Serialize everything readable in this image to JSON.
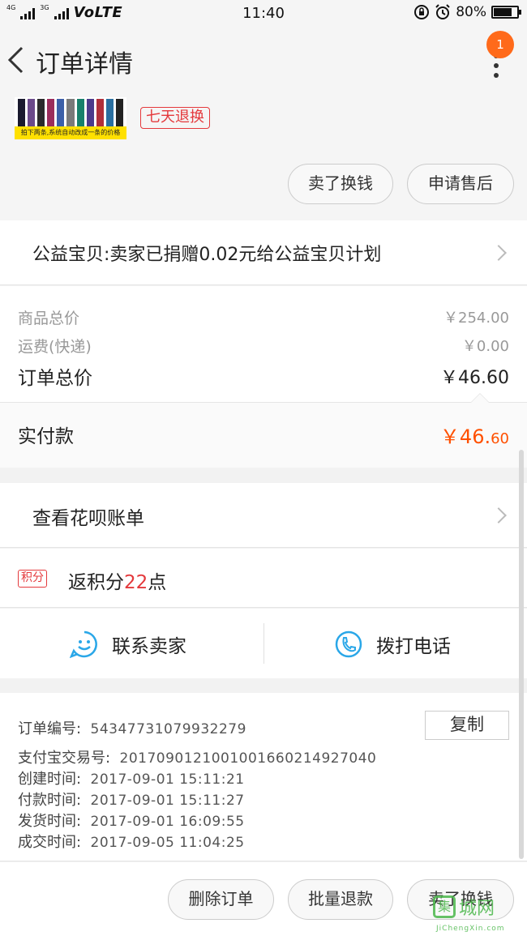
{
  "status_bar": {
    "net_left_small": "4G",
    "net_right_small": "3G",
    "volte": "VoLTE",
    "time": "11:40",
    "battery_percent_label": "80%",
    "battery_level": 0.8
  },
  "nav": {
    "title": "订单详情",
    "badge_count": "1"
  },
  "product": {
    "thumb_caption": "拍下两条,系统自动改成一条的价格",
    "tag": "七天退换",
    "stripe_colors": [
      "#1a1a2e",
      "#6b4a8a",
      "#2b2b2b",
      "#9b2d5b",
      "#3c5fa8",
      "#7a7a7a",
      "#18806b",
      "#4b3b8b",
      "#b0303a",
      "#2a6fa0",
      "#222222"
    ],
    "buttons": {
      "sell": "卖了换钱",
      "after_sale": "申请售后"
    }
  },
  "charity": {
    "text": "公益宝贝:卖家已捐赠0.02元给公益宝贝计划"
  },
  "prices": {
    "goods_total_label": "商品总价",
    "goods_total_value": "￥254.00",
    "shipping_label": "运费(快递)",
    "shipping_value": "￥0.00",
    "order_total_label": "订单总价",
    "order_total_value": "￥46.60"
  },
  "paid": {
    "label": "实付款",
    "value_main": "￥46.",
    "value_dec": "60"
  },
  "huabei": {
    "text": "查看花呗账单"
  },
  "points": {
    "badge": "积分",
    "prefix": "返积分",
    "count": "22",
    "suffix": "点"
  },
  "contact": {
    "seller": "联系卖家",
    "call": "拨打电话"
  },
  "info": {
    "order_no_label": "订单编号:",
    "order_no": "54347731079932279",
    "copy": "复制",
    "alipay_label": "支付宝交易号:",
    "alipay_no": "2017090121001001660214927040",
    "created_label": "创建时间:",
    "created": "2017-09-01 15:11:21",
    "paid_label": "付款时间:",
    "paid": "2017-09-01 15:11:27",
    "shipped_label": "发货时间:",
    "shipped": "2017-09-01 16:09:55",
    "closed_label": "成交时间:",
    "closed": "2017-09-05 11:04:25"
  },
  "bottom": {
    "delete": "删除订单",
    "batch_refund": "批量退款",
    "sell": "卖了换钱"
  },
  "watermark": {
    "glyph": "集",
    "text": "城网",
    "url": "JiChengXin.com"
  }
}
